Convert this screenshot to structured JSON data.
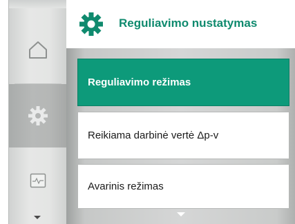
{
  "header": {
    "title": "Reguliavimo nustatymas",
    "icon": "gear-icon"
  },
  "nav": {
    "items": [
      {
        "icon": "home-icon",
        "selected": false
      },
      {
        "icon": "gear-icon",
        "selected": true
      },
      {
        "icon": "diagnostics-icon",
        "selected": false
      }
    ],
    "scroll_icon": "chevron-down-icon"
  },
  "menu": {
    "items": [
      {
        "label": "Reguliavimo režimas",
        "selected": true
      },
      {
        "label": "Reikiama darbinė vertė Δp-v",
        "selected": false
      },
      {
        "label": "Avarinis režimas",
        "selected": false
      }
    ],
    "scroll_icon": "chevron-down-icon"
  },
  "colors": {
    "accent": "#0d9a7a",
    "title": "#0f8a6e"
  }
}
